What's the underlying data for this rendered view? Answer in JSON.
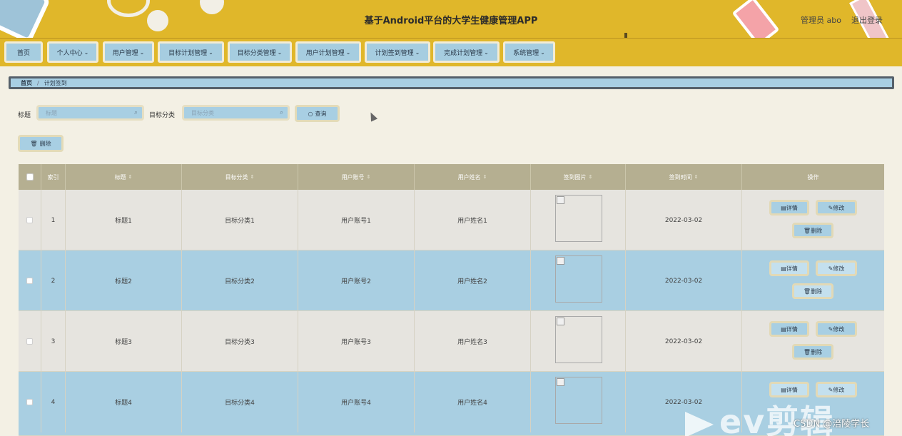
{
  "header": {
    "title": "基于Android平台的大学生健康管理APP",
    "admin": "管理员 abo",
    "logout": "退出登录"
  },
  "nav": [
    {
      "label": "首页",
      "has_menu": false
    },
    {
      "label": "个人中心",
      "has_menu": true
    },
    {
      "label": "用户管理",
      "has_menu": true
    },
    {
      "label": "目标计划管理",
      "has_menu": true
    },
    {
      "label": "目标分类管理",
      "has_menu": true
    },
    {
      "label": "用户计划管理",
      "has_menu": true
    },
    {
      "label": "计划签到管理",
      "has_menu": true
    },
    {
      "label": "完成计划管理",
      "has_menu": true
    },
    {
      "label": "系统管理",
      "has_menu": true
    }
  ],
  "breadcrumb": {
    "home": "首页",
    "sep": "/",
    "current": "计划签到"
  },
  "search": {
    "title_label": "标题",
    "title_placeholder": "标题",
    "category_label": "目标分类",
    "category_placeholder": "目标分类",
    "query_button": "查询"
  },
  "toolbar": {
    "delete_button": "删除"
  },
  "table": {
    "headers": {
      "index": "索引",
      "title": "标题",
      "category": "目标分类",
      "account": "用户账号",
      "name": "用户姓名",
      "image": "签到图片",
      "time": "签到时间",
      "ops": "操作"
    },
    "actions": {
      "detail": "详情",
      "edit": "修改",
      "delete": "删除"
    },
    "rows": [
      {
        "index": "1",
        "title": "标题1",
        "category": "目标分类1",
        "account": "用户账号1",
        "name": "用户姓名1",
        "time": "2022-03-02"
      },
      {
        "index": "2",
        "title": "标题2",
        "category": "目标分类2",
        "account": "用户账号2",
        "name": "用户姓名2",
        "time": "2022-03-02"
      },
      {
        "index": "3",
        "title": "标题3",
        "category": "目标分类3",
        "account": "用户账号3",
        "name": "用户姓名3",
        "time": "2022-03-02"
      },
      {
        "index": "4",
        "title": "标题4",
        "category": "目标分类4",
        "account": "用户账号4",
        "name": "用户姓名4",
        "time": "2022-03-02"
      }
    ]
  },
  "overlay": {
    "watermark": "ev剪辑",
    "credit": "CSDN @涪陵学长"
  },
  "colors": {
    "header_bg": "#e0b72a",
    "accent_blue": "#a8cfe3",
    "table_header": "#b5af91"
  }
}
